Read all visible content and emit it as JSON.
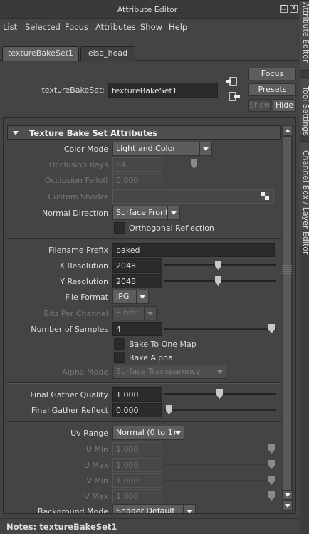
{
  "window": {
    "title": "Attribute Editor"
  },
  "menu": [
    "List",
    "Selected",
    "Focus",
    "Attributes",
    "Show",
    "Help"
  ],
  "tabs": [
    {
      "label": "textureBakeSet1",
      "active": true
    },
    {
      "label": "elsa_head",
      "active": false
    }
  ],
  "node": {
    "label": "textureBakeSet:",
    "value": "textureBakeSet1"
  },
  "buttons": {
    "focus": "Focus",
    "presets": "Presets",
    "show": "Show",
    "hide": "Hide"
  },
  "section": {
    "title": "Texture Bake Set Attributes"
  },
  "attrs": {
    "color_mode": {
      "label": "Color Mode",
      "value": "Light and Color"
    },
    "occlusion_rays": {
      "label": "Occlusion Rays",
      "value": "64",
      "slider_fraction": 0.26
    },
    "occlusion_falloff": {
      "label": "Occlusion Falloff",
      "value": "0.000"
    },
    "custom_shader": {
      "label": "Custom Shader",
      "value": ""
    },
    "normal_direction": {
      "label": "Normal Direction",
      "value": "Surface Front"
    },
    "orthogonal_reflection": {
      "label": "Orthogonal Reflection",
      "checked": false
    },
    "filename_prefix": {
      "label": "Filename Prefix",
      "value": "baked"
    },
    "x_resolution": {
      "label": "X Resolution",
      "value": "2048",
      "slider_fraction": 0.5
    },
    "y_resolution": {
      "label": "Y Resolution",
      "value": "2048",
      "slider_fraction": 0.5
    },
    "file_format": {
      "label": "File Format",
      "value": "JPG"
    },
    "bits_per_channel": {
      "label": "Bits Per Channel",
      "value": "8 bits"
    },
    "number_of_samples": {
      "label": "Number of Samples",
      "value": "4",
      "slider_fraction": 0.97
    },
    "bake_to_one_map": {
      "label": "Bake To One Map",
      "checked": false
    },
    "bake_alpha": {
      "label": "Bake Alpha",
      "checked": false
    },
    "alpha_mode": {
      "label": "Alpha Mode",
      "value": "Surface Transparency"
    },
    "final_gather_quality": {
      "label": "Final Gather Quality",
      "value": "1.000",
      "slider_fraction": 0.5
    },
    "final_gather_reflect": {
      "label": "Final Gather Reflect",
      "value": "0.000",
      "slider_fraction": 0.0
    },
    "uv_range": {
      "label": "Uv Range",
      "value": "Normal (0 to 1)"
    },
    "u_min": {
      "label": "U Min",
      "value": "1.000",
      "slider_fraction": 0.97
    },
    "u_max": {
      "label": "U Max",
      "value": "1.000",
      "slider_fraction": 0.97
    },
    "v_min": {
      "label": "V Min",
      "value": "1.000",
      "slider_fraction": 0.97
    },
    "v_max": {
      "label": "V Max",
      "value": "1.000",
      "slider_fraction": 0.97
    },
    "background_mode": {
      "label": "Background Mode",
      "value": "Shader Default"
    }
  },
  "notes": {
    "label": "Notes:  textureBakeSet1"
  },
  "side_tabs": [
    "Attribute Editor",
    "Tool Settings",
    "Channel Box / Layer Editor"
  ]
}
